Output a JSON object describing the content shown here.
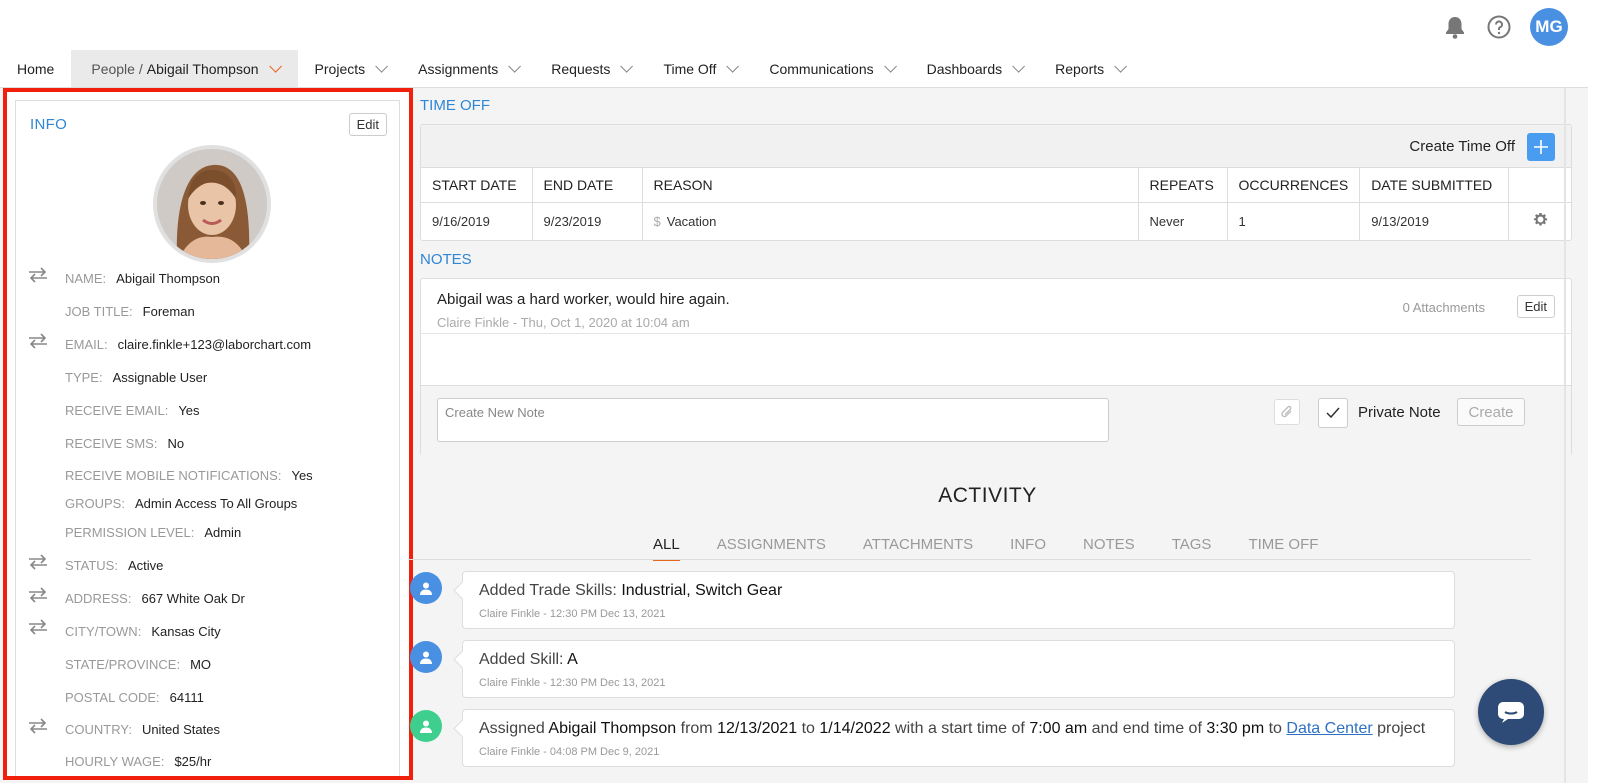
{
  "user_initials": "MG",
  "nav": {
    "home": "Home",
    "people_prefix": "People /",
    "people_name": "Abigail Thompson",
    "projects": "Projects",
    "assignments": "Assignments",
    "requests": "Requests",
    "time_off": "Time Off",
    "communications": "Communications",
    "dashboards": "Dashboards",
    "reports": "Reports"
  },
  "info": {
    "title": "INFO",
    "edit_label": "Edit",
    "fields": [
      {
        "label": "NAME:",
        "value": "Abigail Thompson"
      },
      {
        "label": "JOB TITLE:",
        "value": "Foreman"
      },
      {
        "label": "EMAIL:",
        "value": "claire.finkle+123@laborchart.com"
      },
      {
        "label": "TYPE:",
        "value": "Assignable User"
      },
      {
        "label": "RECEIVE EMAIL:",
        "value": "Yes"
      },
      {
        "label": "RECEIVE SMS:",
        "value": "No"
      },
      {
        "label": "RECEIVE MOBILE NOTIFICATIONS:",
        "value": "Yes"
      },
      {
        "label": "GROUPS:",
        "value": "Admin Access To All Groups"
      },
      {
        "label": "PERMISSION LEVEL:",
        "value": "Admin"
      },
      {
        "label": "STATUS:",
        "value": "Active"
      },
      {
        "label": "ADDRESS:",
        "value": "667 White Oak Dr"
      },
      {
        "label": "CITY/TOWN:",
        "value": "Kansas City"
      },
      {
        "label": "STATE/PROVINCE:",
        "value": "MO"
      },
      {
        "label": "POSTAL CODE:",
        "value": "64111"
      },
      {
        "label": "COUNTRY:",
        "value": "United States"
      },
      {
        "label": "HOURLY WAGE:",
        "value": "$25/hr"
      }
    ]
  },
  "time_off": {
    "title": "TIME OFF",
    "create_label": "Create Time Off",
    "columns": [
      "START DATE",
      "END DATE",
      "REASON",
      "REPEATS",
      "OCCURRENCES",
      "DATE SUBMITTED"
    ],
    "rows": [
      {
        "start": "9/16/2019",
        "end": "9/23/2019",
        "currency": "$",
        "reason": "Vacation",
        "repeats": "Never",
        "occurrences": "1",
        "submitted": "9/13/2019"
      }
    ]
  },
  "notes": {
    "title": "NOTES",
    "note_text": "Abigail was a hard worker, would hire again.",
    "author": "Claire Finkle",
    "separator": "-",
    "timestamp": "Thu, Oct 1, 2020 at 10:04 am",
    "attachments": "0 Attachments",
    "edit_label": "Edit",
    "new_note_placeholder": "Create New Note",
    "private_label": "Private Note",
    "create_label": "Create"
  },
  "activity": {
    "title": "ACTIVITY",
    "tabs": [
      "ALL",
      "ASSIGNMENTS",
      "ATTACHMENTS",
      "INFO",
      "NOTES",
      "TAGS",
      "TIME OFF"
    ],
    "items": [
      {
        "prefix": "Added Trade Skills:",
        "bold": "Industrial, Switch Gear",
        "meta": "Claire Finkle - 12:30 PM Dec 13, 2021",
        "color": "#4a90e2"
      },
      {
        "prefix": "Added Skill:",
        "bold": "A",
        "meta": "Claire Finkle - 12:30 PM Dec 13, 2021",
        "color": "#4a90e2"
      },
      {
        "meta": "Claire Finkle - 04:08 PM Dec 9, 2021",
        "color": "#3ecf8e",
        "p1": "Assigned",
        "name": "Abigail Thompson",
        "p2": "from",
        "d1": "12/13/2021",
        "p3": "to",
        "d2": "1/14/2022",
        "p4": "with a start time of",
        "t1": "7:00 am",
        "p5": "and end time of",
        "t2": "3:30 pm",
        "p6": "to",
        "project": "Data Center",
        "p7": "project"
      }
    ]
  },
  "colors": {
    "accent": "#2f86d6",
    "highlight_border": "#f0200c",
    "tab_underline": "#e8651a"
  }
}
